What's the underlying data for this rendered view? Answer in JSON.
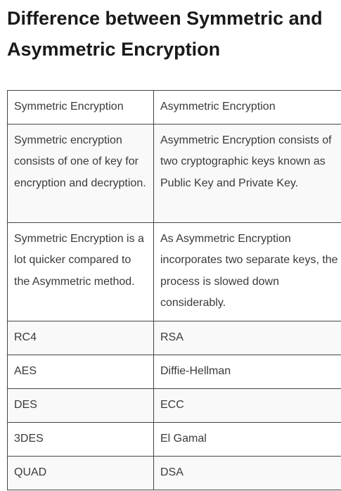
{
  "title": "Difference between Symmetric and Asymmetric Encryption",
  "table": {
    "header": [
      "Symmetric Encryption",
      "Asymmetric Encryption"
    ],
    "rows": [
      [
        "Symmetric encryption consists of one of key for encryption and decryption.",
        "Asymmetric Encryption consists of two cryptographic keys known as Public Key and Private Key."
      ],
      [
        "Symmetric Encryption is a lot quicker compared to the Asymmetric method.",
        "As Asymmetric Encryption incorporates two separate keys, the process is slowed down considerably."
      ],
      [
        "RC4",
        "RSA"
      ],
      [
        "AES",
        "Diffie-Hellman"
      ],
      [
        "DES",
        "ECC"
      ],
      [
        "3DES",
        "El Gamal"
      ],
      [
        "QUAD",
        "DSA"
      ]
    ]
  }
}
